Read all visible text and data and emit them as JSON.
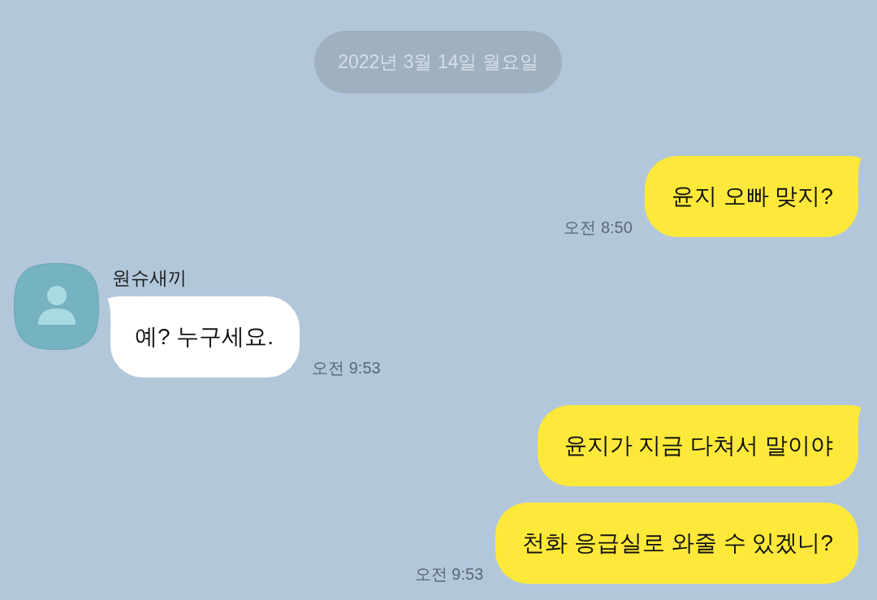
{
  "date_divider": {
    "text": "2022년 3월 14일 월요일"
  },
  "message_groups": [
    {
      "kind": "outgoing",
      "time": "오전 8:50",
      "bubbles": [
        {
          "text": "윤지 오빠 맞지?"
        }
      ]
    },
    {
      "kind": "incoming",
      "sender": "원슈새끼",
      "time": "오전 9:53",
      "bubbles": [
        {
          "text": "예? 누구세요."
        }
      ]
    },
    {
      "kind": "outgoing",
      "time": "오전 9:53",
      "bubbles": [
        {
          "text": "윤지가 지금 다쳐서 말이야"
        },
        {
          "text": "천화 응급실로 와줄 수 있겠니?"
        }
      ]
    }
  ]
}
